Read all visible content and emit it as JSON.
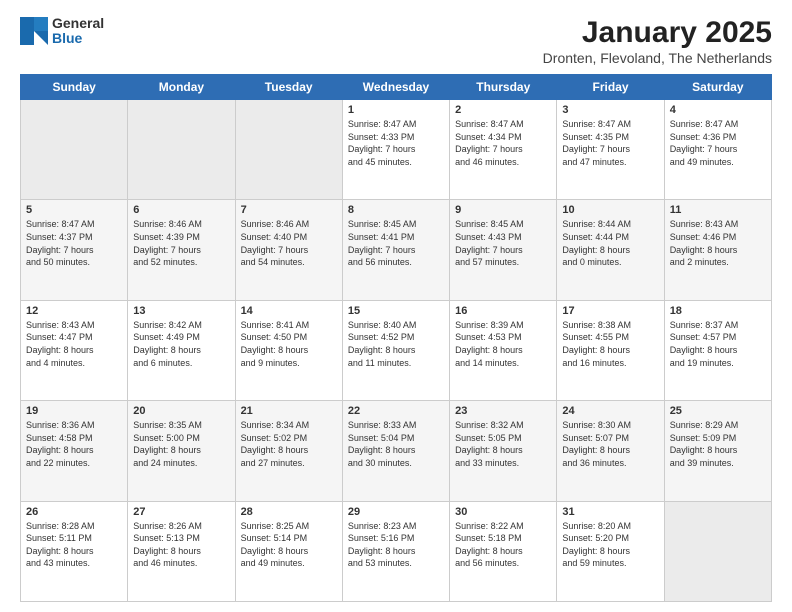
{
  "header": {
    "logo_general": "General",
    "logo_blue": "Blue",
    "month_title": "January 2025",
    "location": "Dronten, Flevoland, The Netherlands"
  },
  "weekdays": [
    "Sunday",
    "Monday",
    "Tuesday",
    "Wednesday",
    "Thursday",
    "Friday",
    "Saturday"
  ],
  "weeks": [
    {
      "days": [
        {
          "num": "",
          "info": ""
        },
        {
          "num": "",
          "info": ""
        },
        {
          "num": "",
          "info": ""
        },
        {
          "num": "1",
          "info": "Sunrise: 8:47 AM\nSunset: 4:33 PM\nDaylight: 7 hours\nand 45 minutes."
        },
        {
          "num": "2",
          "info": "Sunrise: 8:47 AM\nSunset: 4:34 PM\nDaylight: 7 hours\nand 46 minutes."
        },
        {
          "num": "3",
          "info": "Sunrise: 8:47 AM\nSunset: 4:35 PM\nDaylight: 7 hours\nand 47 minutes."
        },
        {
          "num": "4",
          "info": "Sunrise: 8:47 AM\nSunset: 4:36 PM\nDaylight: 7 hours\nand 49 minutes."
        }
      ]
    },
    {
      "days": [
        {
          "num": "5",
          "info": "Sunrise: 8:47 AM\nSunset: 4:37 PM\nDaylight: 7 hours\nand 50 minutes."
        },
        {
          "num": "6",
          "info": "Sunrise: 8:46 AM\nSunset: 4:39 PM\nDaylight: 7 hours\nand 52 minutes."
        },
        {
          "num": "7",
          "info": "Sunrise: 8:46 AM\nSunset: 4:40 PM\nDaylight: 7 hours\nand 54 minutes."
        },
        {
          "num": "8",
          "info": "Sunrise: 8:45 AM\nSunset: 4:41 PM\nDaylight: 7 hours\nand 56 minutes."
        },
        {
          "num": "9",
          "info": "Sunrise: 8:45 AM\nSunset: 4:43 PM\nDaylight: 7 hours\nand 57 minutes."
        },
        {
          "num": "10",
          "info": "Sunrise: 8:44 AM\nSunset: 4:44 PM\nDaylight: 8 hours\nand 0 minutes."
        },
        {
          "num": "11",
          "info": "Sunrise: 8:43 AM\nSunset: 4:46 PM\nDaylight: 8 hours\nand 2 minutes."
        }
      ]
    },
    {
      "days": [
        {
          "num": "12",
          "info": "Sunrise: 8:43 AM\nSunset: 4:47 PM\nDaylight: 8 hours\nand 4 minutes."
        },
        {
          "num": "13",
          "info": "Sunrise: 8:42 AM\nSunset: 4:49 PM\nDaylight: 8 hours\nand 6 minutes."
        },
        {
          "num": "14",
          "info": "Sunrise: 8:41 AM\nSunset: 4:50 PM\nDaylight: 8 hours\nand 9 minutes."
        },
        {
          "num": "15",
          "info": "Sunrise: 8:40 AM\nSunset: 4:52 PM\nDaylight: 8 hours\nand 11 minutes."
        },
        {
          "num": "16",
          "info": "Sunrise: 8:39 AM\nSunset: 4:53 PM\nDaylight: 8 hours\nand 14 minutes."
        },
        {
          "num": "17",
          "info": "Sunrise: 8:38 AM\nSunset: 4:55 PM\nDaylight: 8 hours\nand 16 minutes."
        },
        {
          "num": "18",
          "info": "Sunrise: 8:37 AM\nSunset: 4:57 PM\nDaylight: 8 hours\nand 19 minutes."
        }
      ]
    },
    {
      "days": [
        {
          "num": "19",
          "info": "Sunrise: 8:36 AM\nSunset: 4:58 PM\nDaylight: 8 hours\nand 22 minutes."
        },
        {
          "num": "20",
          "info": "Sunrise: 8:35 AM\nSunset: 5:00 PM\nDaylight: 8 hours\nand 24 minutes."
        },
        {
          "num": "21",
          "info": "Sunrise: 8:34 AM\nSunset: 5:02 PM\nDaylight: 8 hours\nand 27 minutes."
        },
        {
          "num": "22",
          "info": "Sunrise: 8:33 AM\nSunset: 5:04 PM\nDaylight: 8 hours\nand 30 minutes."
        },
        {
          "num": "23",
          "info": "Sunrise: 8:32 AM\nSunset: 5:05 PM\nDaylight: 8 hours\nand 33 minutes."
        },
        {
          "num": "24",
          "info": "Sunrise: 8:30 AM\nSunset: 5:07 PM\nDaylight: 8 hours\nand 36 minutes."
        },
        {
          "num": "25",
          "info": "Sunrise: 8:29 AM\nSunset: 5:09 PM\nDaylight: 8 hours\nand 39 minutes."
        }
      ]
    },
    {
      "days": [
        {
          "num": "26",
          "info": "Sunrise: 8:28 AM\nSunset: 5:11 PM\nDaylight: 8 hours\nand 43 minutes."
        },
        {
          "num": "27",
          "info": "Sunrise: 8:26 AM\nSunset: 5:13 PM\nDaylight: 8 hours\nand 46 minutes."
        },
        {
          "num": "28",
          "info": "Sunrise: 8:25 AM\nSunset: 5:14 PM\nDaylight: 8 hours\nand 49 minutes."
        },
        {
          "num": "29",
          "info": "Sunrise: 8:23 AM\nSunset: 5:16 PM\nDaylight: 8 hours\nand 53 minutes."
        },
        {
          "num": "30",
          "info": "Sunrise: 8:22 AM\nSunset: 5:18 PM\nDaylight: 8 hours\nand 56 minutes."
        },
        {
          "num": "31",
          "info": "Sunrise: 8:20 AM\nSunset: 5:20 PM\nDaylight: 8 hours\nand 59 minutes."
        },
        {
          "num": "",
          "info": ""
        }
      ]
    }
  ]
}
